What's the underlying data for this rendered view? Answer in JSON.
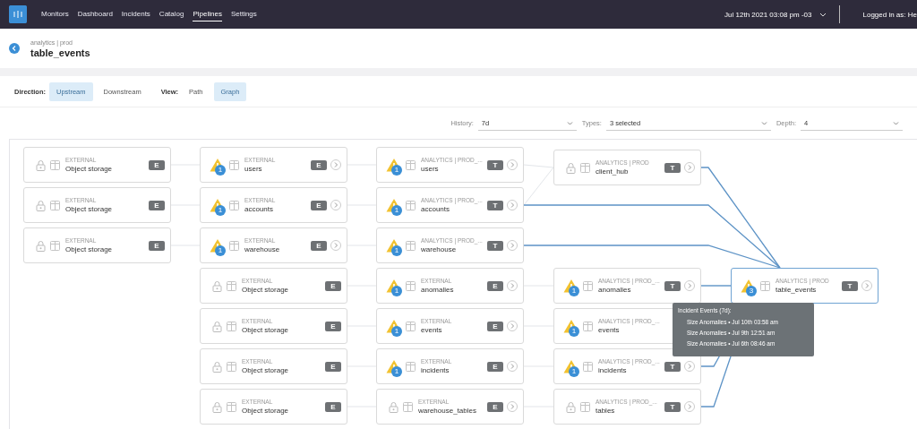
{
  "nav": {
    "items": [
      {
        "label": "Monitors",
        "selected": false
      },
      {
        "label": "Dashboard",
        "selected": false
      },
      {
        "label": "Incidents",
        "selected": false
      },
      {
        "label": "Catalog",
        "selected": false
      },
      {
        "label": "Pipelines",
        "selected": true
      },
      {
        "label": "Settings",
        "selected": false
      }
    ],
    "datetime": "Jul 12th 2021 03:08 pm -03",
    "user": "Logged in as: He"
  },
  "page": {
    "breadcrumb": "analytics | prod",
    "title": "table_events"
  },
  "toolbar": {
    "direction_label": "Direction:",
    "direction_options": [
      {
        "label": "Upstream",
        "selected": true
      },
      {
        "label": "Downstream",
        "selected": false
      }
    ],
    "view_label": "View:",
    "view_options": [
      {
        "label": "Path",
        "selected": false
      },
      {
        "label": "Graph",
        "selected": true
      }
    ]
  },
  "filters": [
    {
      "label": "History:",
      "value": "7d"
    },
    {
      "label": "Types:",
      "value": "3 selected"
    },
    {
      "label": "Depth:",
      "value": "4"
    }
  ],
  "graph": {
    "columns": [
      {
        "nodes": [
          {
            "kind": "locked",
            "source": "EXTERNAL",
            "name": "Object storage",
            "type": "E",
            "expandable": false,
            "selected": false,
            "links": [
              {
                "highlighted": false
              }
            ]
          },
          {
            "kind": "locked",
            "source": "EXTERNAL",
            "name": "Object storage",
            "type": "E",
            "expandable": false,
            "selected": false,
            "links": [
              {
                "highlighted": false
              }
            ]
          },
          {
            "kind": "locked",
            "source": "EXTERNAL",
            "name": "Object storage",
            "type": "E",
            "expandable": false,
            "selected": false,
            "links": [
              {
                "highlighted": false
              }
            ]
          }
        ]
      },
      {
        "nodes": [
          {
            "kind": "warning",
            "incidents": "1",
            "source": "EXTERNAL",
            "name": "users",
            "type": "E",
            "expandable": true,
            "selected": false,
            "links": [
              {
                "highlighted": false
              }
            ]
          },
          {
            "kind": "warning",
            "incidents": "1",
            "source": "EXTERNAL",
            "name": "accounts",
            "type": "E",
            "expandable": true,
            "selected": false,
            "links": [
              {
                "highlighted": false
              }
            ]
          },
          {
            "kind": "warning",
            "incidents": "1",
            "source": "EXTERNAL",
            "name": "warehouse",
            "type": "E",
            "expandable": true,
            "selected": false,
            "links": [
              {
                "highlighted": false
              }
            ]
          },
          {
            "kind": "locked",
            "source": "EXTERNAL",
            "name": "Object storage",
            "type": "E",
            "expandable": false,
            "selected": false,
            "links": [
              {
                "highlighted": false
              }
            ]
          },
          {
            "kind": "locked",
            "source": "EXTERNAL",
            "name": "Object storage",
            "type": "E",
            "expandable": false,
            "selected": false,
            "links": [
              {
                "highlighted": false
              }
            ]
          },
          {
            "kind": "locked",
            "source": "EXTERNAL",
            "name": "Object storage",
            "type": "E",
            "expandable": false,
            "selected": false,
            "links": [
              {
                "highlighted": false
              }
            ]
          },
          {
            "kind": "locked",
            "source": "EXTERNAL",
            "name": "Object storage",
            "type": "E",
            "expandable": false,
            "selected": false,
            "links": [
              {
                "highlighted": false
              }
            ]
          }
        ]
      },
      {
        "nodes": [
          {
            "kind": "warning",
            "incidents": "1",
            "source": "ANALYTICS | PROD_...",
            "name": "users",
            "type": "T",
            "expandable": true,
            "selected": false,
            "links": [
              {
                "highlighted": false
              }
            ]
          },
          {
            "kind": "warning",
            "incidents": "1",
            "source": "ANALYTICS | PROD_...",
            "name": "accounts",
            "type": "T",
            "expandable": true,
            "selected": false,
            "links": [
              {
                "highlighted": false
              },
              {
                "highlighted": true
              }
            ]
          },
          {
            "kind": "warning",
            "incidents": "1",
            "source": "ANALYTICS | PROD_...",
            "name": "warehouse",
            "type": "T",
            "expandable": true,
            "selected": false,
            "links": [
              {
                "highlighted": true
              }
            ]
          },
          {
            "kind": "warning",
            "incidents": "1",
            "source": "EXTERNAL",
            "name": "anomalies",
            "type": "E",
            "expandable": true,
            "selected": false,
            "links": [
              {
                "highlighted": false
              }
            ]
          },
          {
            "kind": "warning",
            "incidents": "1",
            "source": "EXTERNAL",
            "name": "events",
            "type": "E",
            "expandable": true,
            "selected": false,
            "links": [
              {
                "highlighted": false
              }
            ]
          },
          {
            "kind": "warning",
            "incidents": "1",
            "source": "EXTERNAL",
            "name": "incidents",
            "type": "E",
            "expandable": true,
            "selected": false,
            "links": [
              {
                "highlighted": false
              }
            ]
          },
          {
            "kind": "locked",
            "source": "EXTERNAL",
            "name": "warehouse_tables",
            "type": "E",
            "expandable": true,
            "selected": false,
            "links": [
              {
                "highlighted": false
              }
            ]
          }
        ]
      },
      {
        "nodes": [
          {
            "kind": "locked",
            "source": "ANALYTICS | PROD",
            "name": "client_hub",
            "type": "T",
            "expandable": true,
            "selected": false,
            "links": [
              {
                "highlighted": true
              }
            ]
          },
          {
            "kind": "warning",
            "incidents": "1",
            "source": "ANALYTICS | PROD_...",
            "name": "anomalies",
            "type": "T",
            "expandable": true,
            "selected": false,
            "links": [
              {
                "highlighted": true
              }
            ]
          },
          {
            "kind": "warning",
            "incidents": "1",
            "source": "ANALYTICS | PROD_...",
            "name": "events",
            "expandable": false,
            "selected": false
          },
          {
            "kind": "warning",
            "incidents": "1",
            "source": "ANALYTICS | PROD_...",
            "name": "incidents",
            "type": "T",
            "expandable": true,
            "selected": false,
            "links": [
              {
                "highlighted": true
              }
            ]
          },
          {
            "kind": "locked",
            "source": "ANALYTICS | PROD_...",
            "name": "tables",
            "type": "T",
            "expandable": true,
            "selected": false,
            "links": [
              {
                "highlighted": true
              }
            ]
          }
        ]
      },
      {
        "nodes": [
          {
            "kind": "warning",
            "incidents": "3",
            "source": "ANALYTICS | PROD",
            "name": "table_events",
            "type": "T",
            "expandable": true,
            "selected": true
          }
        ]
      }
    ],
    "tooltip": {
      "title": "Incident Events (7d):",
      "lines": [
        "Size Anomalies • Jul 10th 03:58 am",
        "Size Anomalies • Jul 9th 12:51 am",
        "Size Anomalies • Jul 6th 08:46 am"
      ]
    }
  }
}
